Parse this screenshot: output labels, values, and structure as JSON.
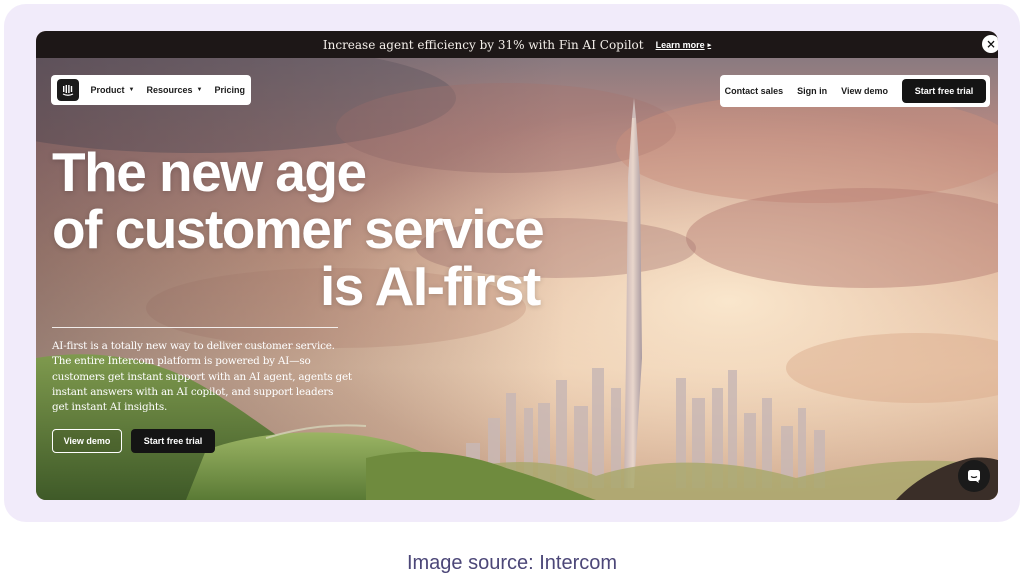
{
  "announcement": {
    "text": "Increase agent efficiency by 31% with Fin AI Copilot",
    "link_label": "Learn more",
    "link_arrow": "▸",
    "close_icon": "×"
  },
  "nav": {
    "logo_icon": "intercom-logo",
    "left_items": [
      {
        "label": "Product",
        "caret": "▼"
      },
      {
        "label": "Resources",
        "caret": "▼"
      },
      {
        "label": "Pricing"
      }
    ],
    "contact_sales": "Contact sales",
    "sign_in": "Sign in",
    "view_demo": "View demo",
    "start_trial": "Start free trial"
  },
  "hero": {
    "headline_line1": "The new age",
    "headline_line2": "of customer service",
    "headline_line3": "is AI-first",
    "description": "AI-first is a totally new way to deliver customer service. The entire Intercom platform is powered by AI—so customers get instant support with an AI agent, agents get instant answers with an AI copilot, and support leaders get instant AI insights.",
    "view_demo": "View demo",
    "start_trial": "Start free trial"
  },
  "chat_widget_icon": "chat-icon",
  "caption": "Image source: Intercom",
  "colors": {
    "frame_bg": "#f1ebfa",
    "announce_bg": "#1d1717",
    "caption_text": "#4c4778",
    "button_dark": "#141414"
  }
}
